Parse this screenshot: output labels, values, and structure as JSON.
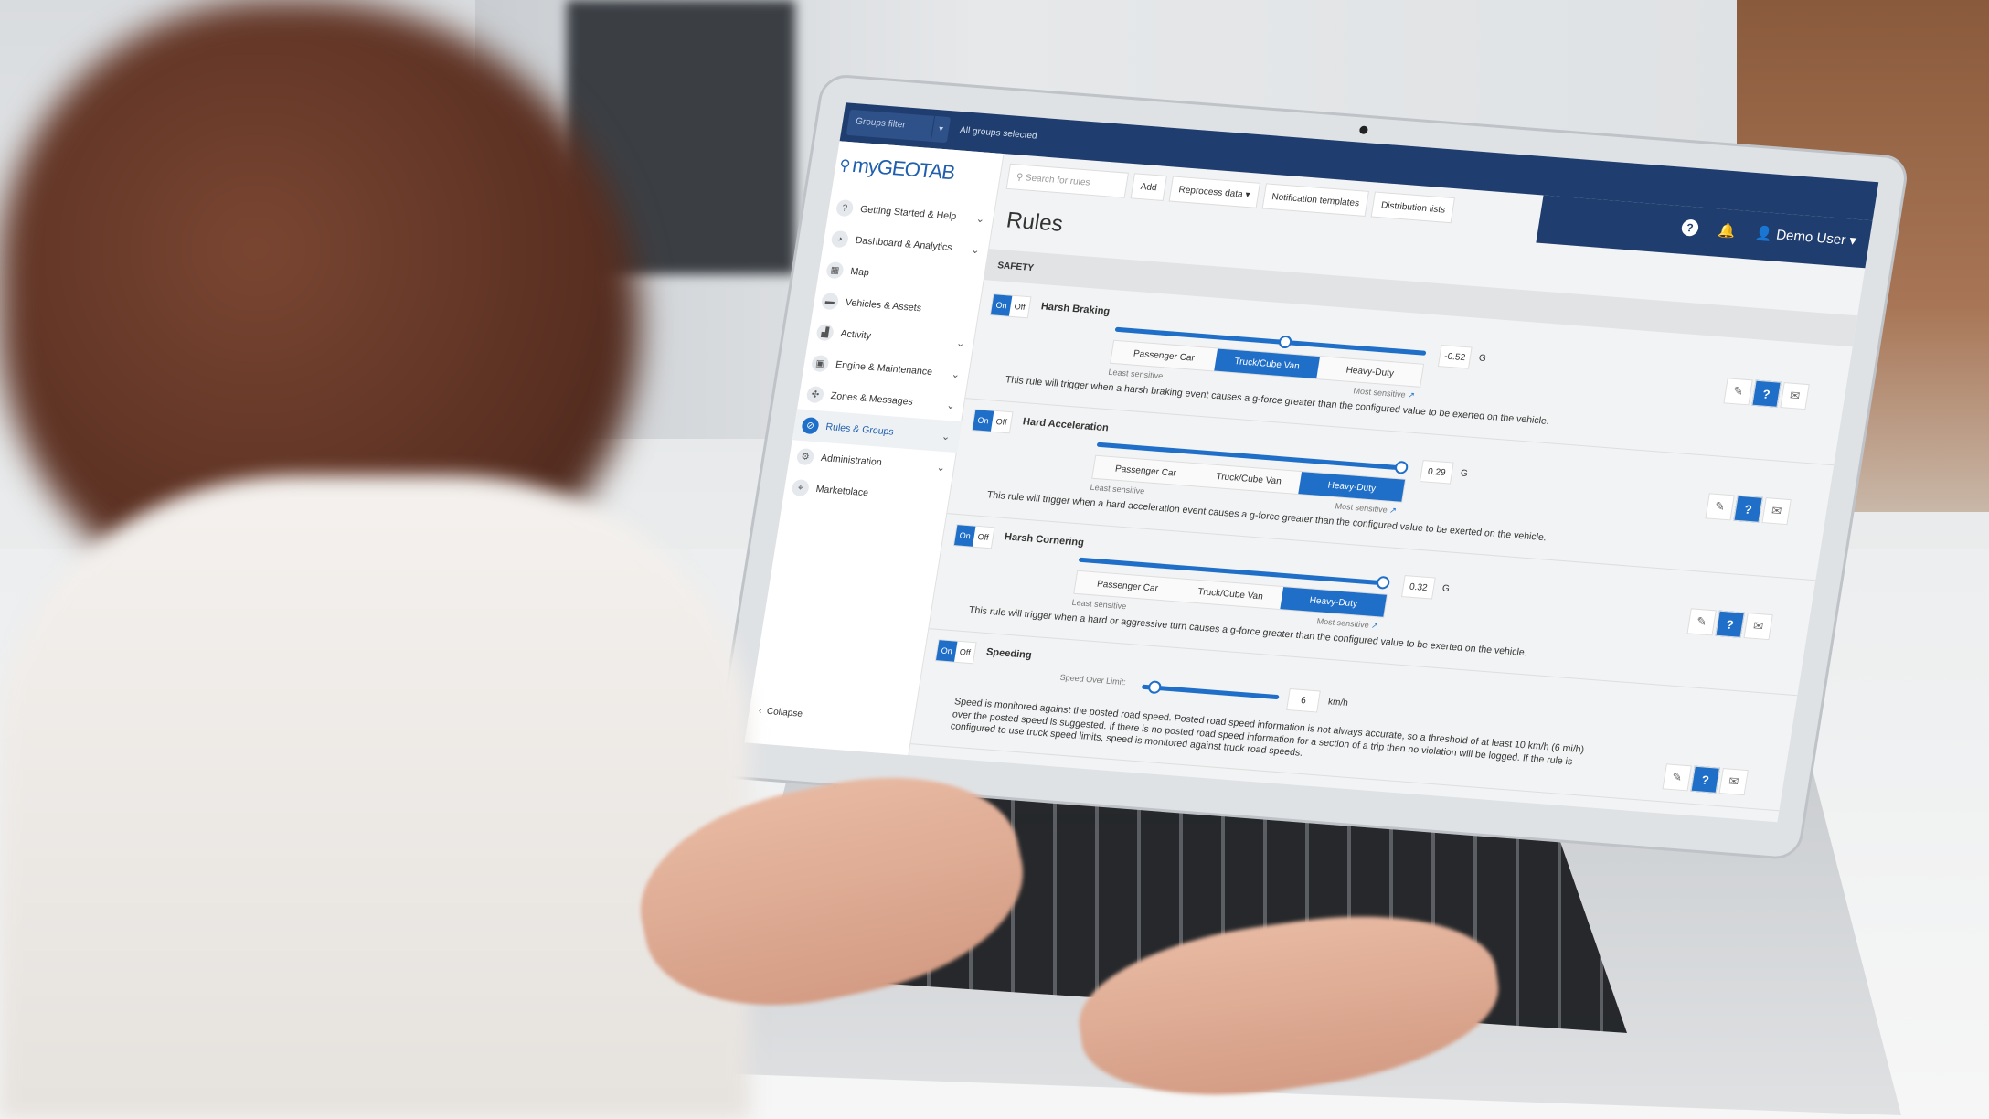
{
  "topbar": {
    "groups_filter": "Groups filter",
    "groups_value": "All groups selected"
  },
  "brand": {
    "logo_my": "my",
    "logo_geotab": "GEOTAB"
  },
  "sidebar": {
    "items": [
      {
        "label": "Getting Started & Help",
        "icon": "help-icon",
        "expandable": true
      },
      {
        "label": "Dashboard & Analytics",
        "icon": "pie-chart-icon",
        "expandable": true
      },
      {
        "label": "Map",
        "icon": "map-icon",
        "expandable": false
      },
      {
        "label": "Vehicles & Assets",
        "icon": "truck-icon",
        "expandable": false
      },
      {
        "label": "Activity",
        "icon": "activity-chart-icon",
        "expandable": true
      },
      {
        "label": "Engine & Maintenance",
        "icon": "engine-icon",
        "expandable": true
      },
      {
        "label": "Zones & Messages",
        "icon": "zones-icon",
        "expandable": true
      },
      {
        "label": "Rules & Groups",
        "icon": "rules-icon",
        "expandable": true,
        "active": true
      },
      {
        "label": "Administration",
        "icon": "gear-icon",
        "expandable": true
      },
      {
        "label": "Marketplace",
        "icon": "location-pin-icon",
        "expandable": false
      }
    ],
    "collapse": "Collapse"
  },
  "toolbar": {
    "search_placeholder": "Search for rules",
    "add": "Add",
    "reprocess": "Reprocess data",
    "notification_templates": "Notification templates",
    "distribution_lists": "Distribution lists"
  },
  "header": {
    "user": "Demo User"
  },
  "page": {
    "title": "Rules",
    "section": "SAFETY"
  },
  "common": {
    "on": "On",
    "off": "Off",
    "least": "Least sensitive",
    "most": "Most sensitive",
    "presets": [
      "Passenger Car",
      "Truck/Cube Van",
      "Heavy-Duty"
    ]
  },
  "rules": [
    {
      "name": "Harsh Braking",
      "enabled": true,
      "value": "-0.52",
      "unit": "G",
      "slider_fraction": 0.55,
      "selected_preset": "Truck/Cube Van",
      "description": "This rule will trigger when a harsh braking event causes a g-force greater than the configured value to be exerted on the vehicle."
    },
    {
      "name": "Hard Acceleration",
      "enabled": true,
      "value": "0.29",
      "unit": "G",
      "slider_fraction": 1.0,
      "selected_preset": "Heavy-Duty",
      "description": "This rule will trigger when a hard acceleration event causes a g-force greater than the configured value to be exerted on the vehicle."
    },
    {
      "name": "Harsh Cornering",
      "enabled": true,
      "value": "0.32",
      "unit": "G",
      "slider_fraction": 1.0,
      "selected_preset": "Heavy-Duty",
      "description": "This rule will trigger when a hard or aggressive turn causes a g-force greater than the configured value to be exerted on the vehicle."
    },
    {
      "name": "Speeding",
      "enabled": true,
      "label": "Speed Over Limit:",
      "value": "6",
      "unit": "km/h",
      "slider_fraction": 0.05,
      "description": "Speed is monitored against the posted road speed. Posted road speed information is not always accurate, so a threshold of at least 10 km/h (6 mi/h) over the posted speed is suggested. If there is no posted road speed information for a section of a trip then no violation will be logged. If the rule is configured to use truck speed limits, speed is monitored against truck road speeds."
    }
  ],
  "colors": {
    "navy": "#1f3d6e",
    "accent": "#1f6fc9"
  }
}
